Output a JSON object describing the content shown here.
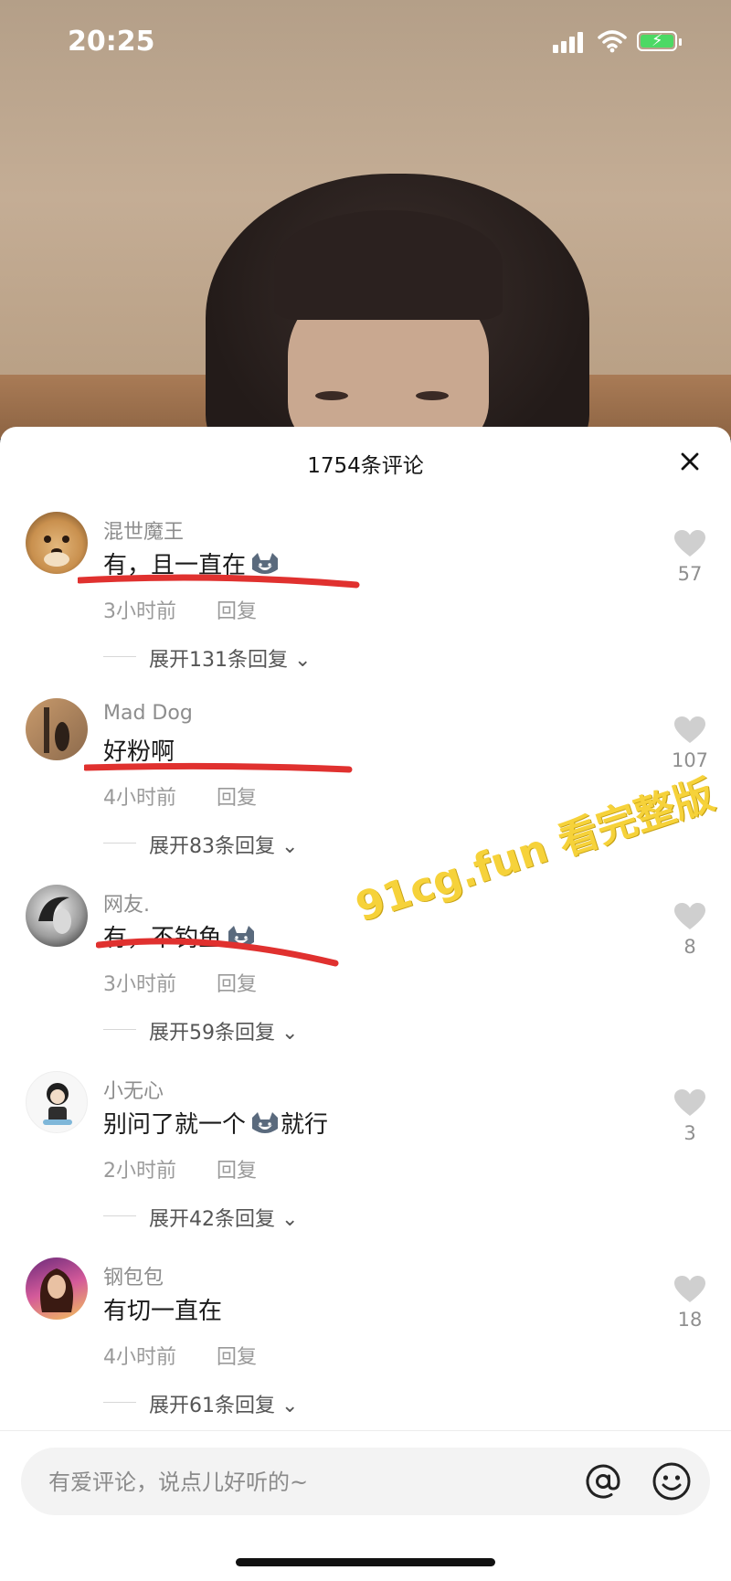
{
  "status_bar": {
    "time": "20:25"
  },
  "comments_panel": {
    "title": "1754条评论",
    "comments": [
      {
        "name": "混世魔王",
        "text": "有，且一直在",
        "has_cat_emoji": true,
        "time": "3小时前",
        "reply": "回复",
        "expand": "展开131条回复",
        "likes": "57"
      },
      {
        "name": "Mad Dog",
        "text": "好粉啊",
        "has_cat_emoji": false,
        "time": "4小时前",
        "reply": "回复",
        "expand": "展开83条回复",
        "likes": "107"
      },
      {
        "name": "网友.",
        "text": "有，不钓鱼",
        "has_cat_emoji": true,
        "time": "3小时前",
        "reply": "回复",
        "expand": "展开59条回复",
        "likes": "8"
      },
      {
        "name": "小无心",
        "text": "别问了就一个",
        "text_after": "就行",
        "has_cat_emoji": true,
        "time": "2小时前",
        "reply": "回复",
        "expand": "展开42条回复",
        "likes": "3"
      },
      {
        "name": "钢包包",
        "text": "有切一直在",
        "has_cat_emoji": false,
        "time": "4小时前",
        "reply": "回复",
        "expand": "展开61条回复",
        "likes": "18"
      }
    ]
  },
  "watermark": "91cg.fun 看完整版",
  "input": {
    "placeholder": "有爱评论，说点儿好听的~"
  },
  "colors": {
    "underline_red": "#e0312f",
    "watermark_yellow": "#f6cf2a",
    "sheet_bg": "#ffffff"
  }
}
